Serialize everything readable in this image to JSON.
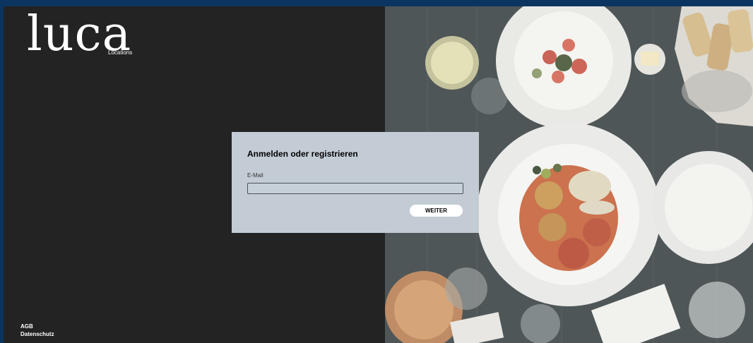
{
  "brand": {
    "logo_text": "luca",
    "subtitle": "Locations"
  },
  "login": {
    "title": "Anmelden oder registrieren",
    "email_label": "E-Mail",
    "email_value": "",
    "submit_label": "WEITER"
  },
  "footer": {
    "links": [
      "AGB",
      "Datenschutz"
    ]
  },
  "colors": {
    "outer_frame": "#0b3560",
    "left_panel": "#232323",
    "card_background": "#c3ccd5",
    "button_background": "#ffffff"
  },
  "hero_image": {
    "icon": "restaurant-table-photo"
  }
}
